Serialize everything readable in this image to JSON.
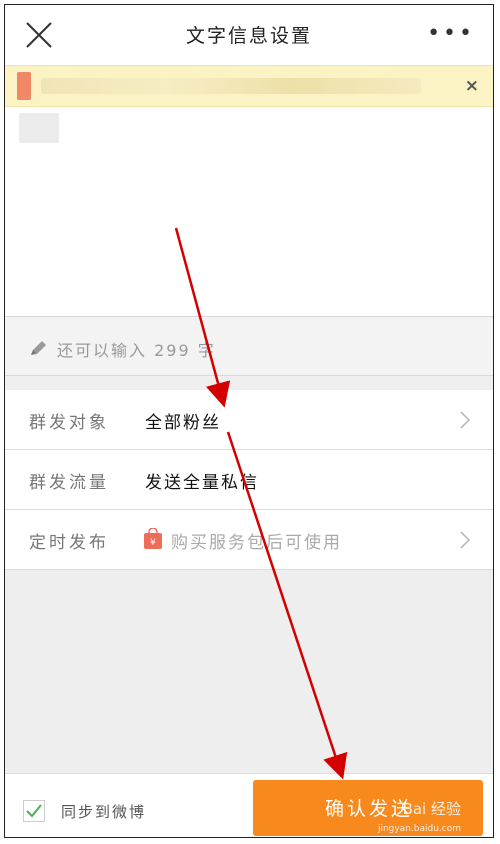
{
  "header": {
    "title": "文字信息设置",
    "more_label": "•••"
  },
  "notice": {
    "close_label": "×"
  },
  "counter": {
    "text": "还可以输入 299 字"
  },
  "settings": {
    "audience_label": "群发对象",
    "audience_value": "全部粉丝",
    "traffic_label": "群发流量",
    "traffic_value": "发送全量私信",
    "schedule_label": "定时发布",
    "schedule_value": "购买服务包后可使用"
  },
  "footer": {
    "sync_label": "同步到微博",
    "sync_checked": true,
    "confirm_label": "确认发送",
    "watermark": "Bai 经验",
    "watermark_url": "jingyan.baidu.com"
  },
  "colors": {
    "accent": "#f7891d",
    "notice_bg": "#fcf3c4",
    "check": "#4caf50",
    "arrow": "#d40000"
  }
}
